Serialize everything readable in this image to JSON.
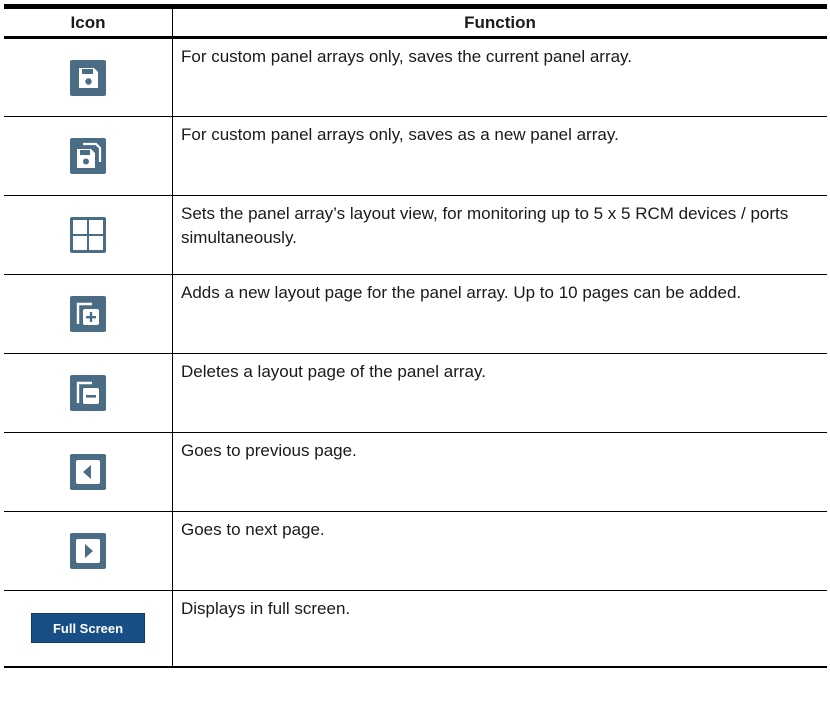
{
  "table": {
    "headers": {
      "icon": "Icon",
      "function": "Function"
    },
    "rows": [
      {
        "icon": "save-icon",
        "function": "For custom panel arrays only, saves the current panel array."
      },
      {
        "icon": "save-as-icon",
        "function": "For custom panel arrays only, saves as a new panel array."
      },
      {
        "icon": "grid-layout-icon",
        "function": "Sets the panel array’s layout view, for monitoring up to 5 x 5 RCM devices / ports simultaneously."
      },
      {
        "icon": "add-page-icon",
        "function": "Adds a new layout page for the panel array. Up to 10 pages can be added."
      },
      {
        "icon": "delete-page-icon",
        "function": "Deletes a layout page of the panel array."
      },
      {
        "icon": "previous-page-icon",
        "function": "Goes to previous page."
      },
      {
        "icon": "next-page-icon",
        "function": "Goes to next page."
      },
      {
        "icon": "full-screen-button",
        "button_label": "Full Screen",
        "function": "Displays in full screen."
      }
    ]
  },
  "colors": {
    "icon_background": "#4a6d85",
    "button_background": "#164e85",
    "button_text": "#ffffff"
  }
}
